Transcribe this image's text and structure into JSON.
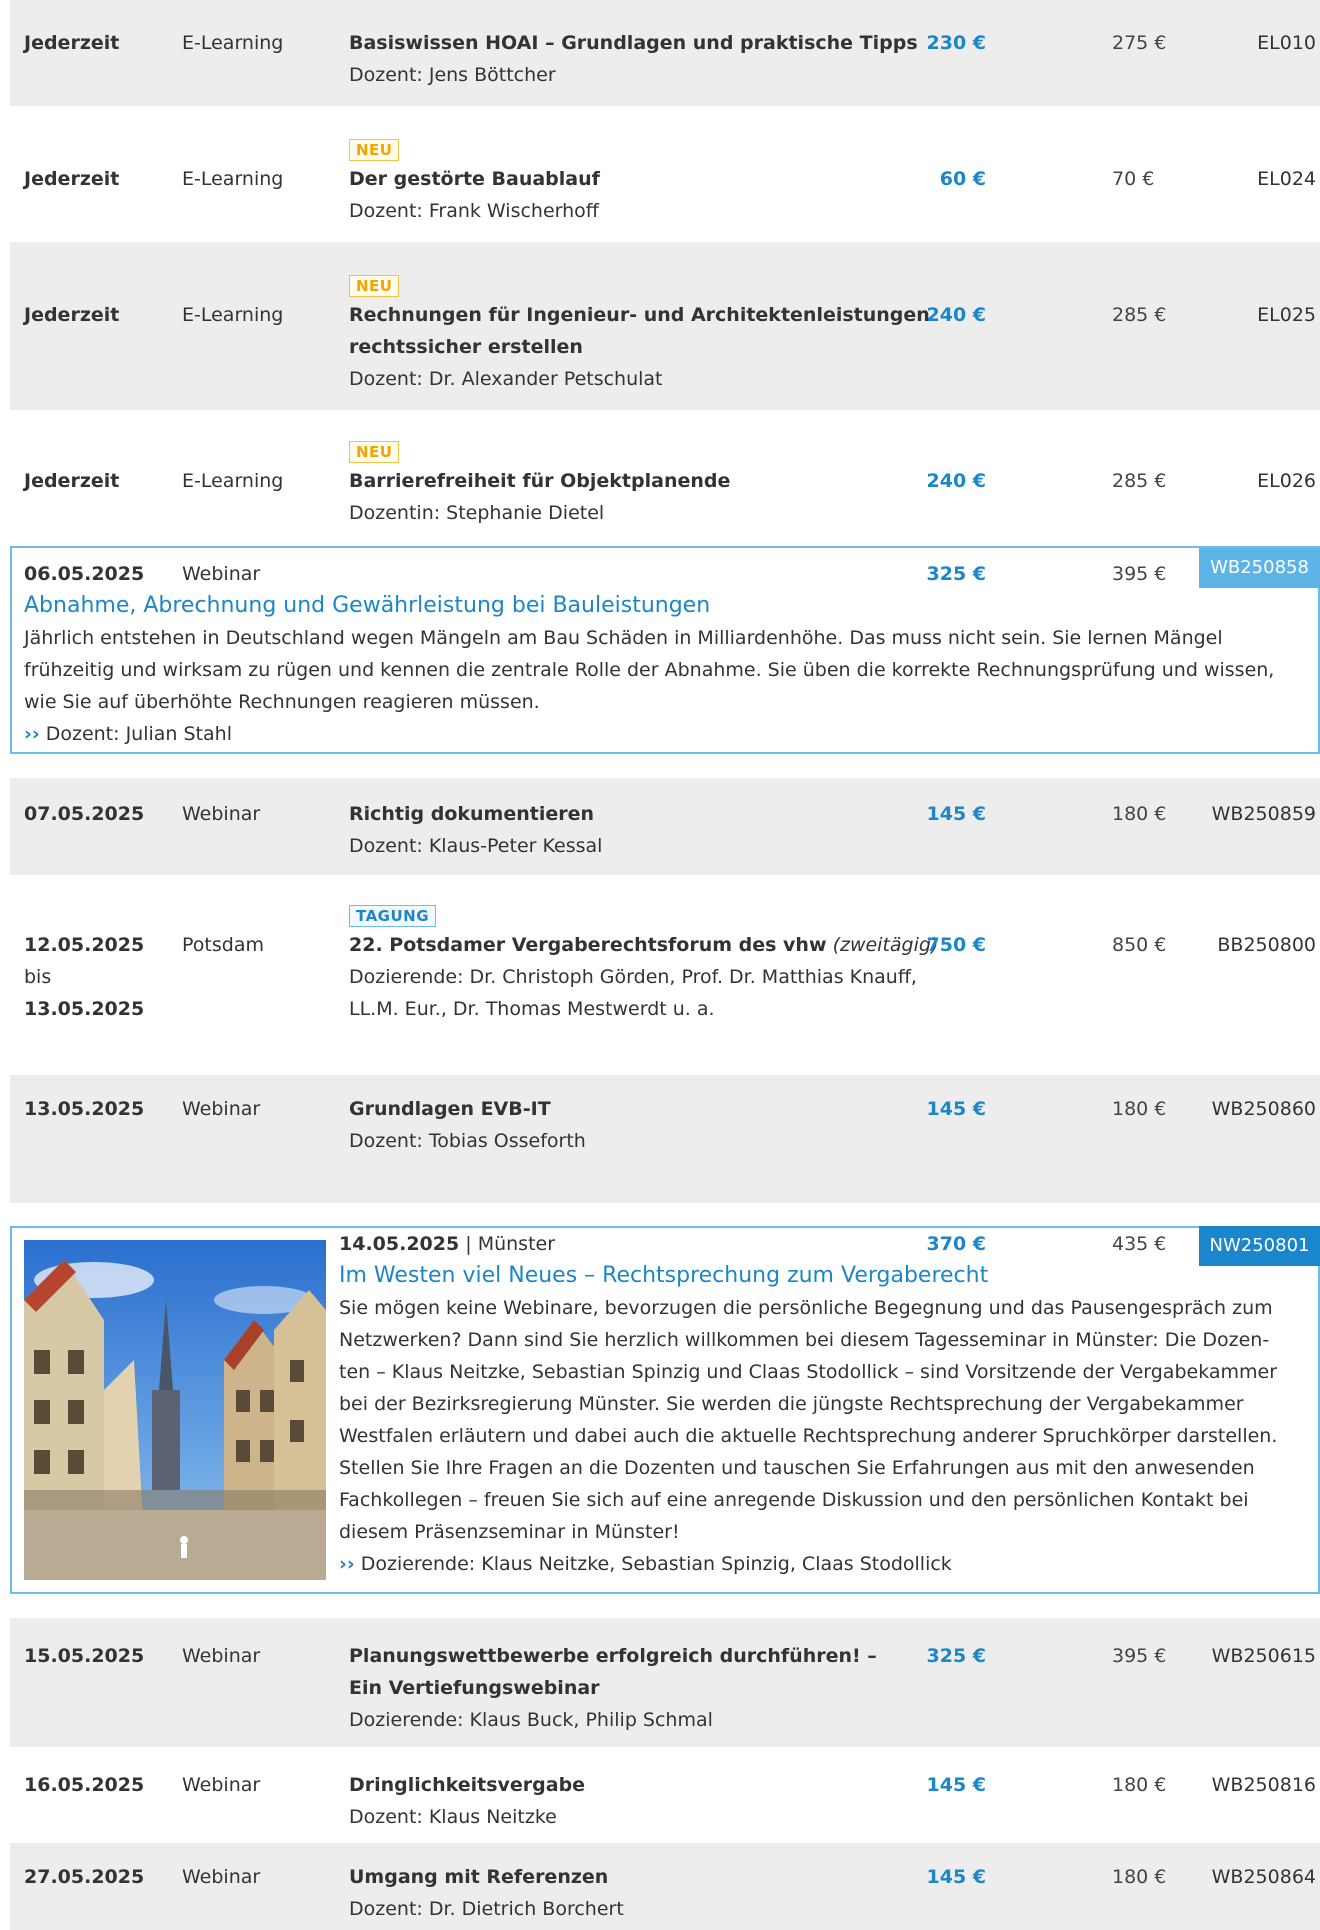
{
  "rows": [
    {
      "date": "Jederzeit",
      "type": "E-Learning",
      "title": "Basiswissen HOAI – Grundlagen und praktische Tipps",
      "lecturer": "Dozent: Jens Böttcher",
      "price_member": "230 €",
      "price_regular": "275 €",
      "code": "EL010"
    },
    {
      "badge": "NEU",
      "date": "Jederzeit",
      "type": "E-Learning",
      "title": "Der gestörte Bauablauf",
      "lecturer": "Dozent: Frank Wischerhoff",
      "price_member": "60 €",
      "price_regular": "70 €",
      "code": "EL024"
    },
    {
      "badge": "NEU",
      "date": "Jederzeit",
      "type": "E-Learning",
      "title_line1": "Rechnungen für Ingenieur- und Architektenleistungen",
      "title_line2": "rechtssicher erstellen",
      "lecturer": "Dozent: Dr. Alexander Petschulat",
      "price_member": "240 €",
      "price_regular": "285 €",
      "code": "EL025"
    },
    {
      "badge": "NEU",
      "date": "Jederzeit",
      "type": "E-Learning",
      "title": "Barrierefreiheit für Objektplanende",
      "lecturer": "Dozentin: Stephanie Dietel",
      "price_member": "240 €",
      "price_regular": "285 €",
      "code": "EL026"
    }
  ],
  "featured1": {
    "date": "06.05.2025",
    "type": "Webinar",
    "title": "Abnahme, Abrechnung und Gewährleistung bei Bauleistungen",
    "desc_line1": "Jährlich entstehen in Deutschland wegen Mängeln am Bau Schäden in Milliardenhöhe. Das muss nicht sein. Sie lernen Mängel",
    "desc_line2": "frühzeitig und wirksam zu rügen und kennen die zentrale Rolle der Abnahme. Sie üben die korrekte Rechnungsprüfung und wissen,",
    "desc_line3": "wie Sie auf überhöhte Rechnungen reagieren müssen.",
    "arrow": "››",
    "lecturer": "Dozent: Julian Stahl",
    "price_member": "325 €",
    "price_regular": "395 €",
    "code": "WB250858"
  },
  "rows2": [
    {
      "date": "07.05.2025",
      "type": "Webinar",
      "title": "Richtig dokumentieren",
      "lecturer": "Dozent: Klaus-Peter Kessal",
      "price_member": "145 €",
      "price_regular": "180 €",
      "code": "WB250859"
    },
    {
      "badge": "TAGUNG",
      "date": "12.05.2025",
      "date_mid": "bis",
      "date_end": "13.05.2025",
      "type": "Potsdam",
      "title": "22. Potsdamer Vergaberechtsforum des vhw",
      "title_suffix": "(zweitägig)",
      "lecturer_line1": "Dozierende: Dr. Christoph Görden, Prof. Dr. Matthias Knauff,",
      "lecturer_line2": "LL.M. Eur., Dr. Thomas Mestwerdt u. a.",
      "price_member": "750 €",
      "price_regular": "850 €",
      "code": "BB250800"
    },
    {
      "date": "13.05.2025",
      "type": "Webinar",
      "title": "Grundlagen EVB-IT",
      "lecturer": "Dozent: Tobias Osseforth",
      "price_member": "145 €",
      "price_regular": "180 €",
      "code": "WB250860"
    }
  ],
  "featured2": {
    "date": "14.05.2025",
    "separator": "|",
    "location": "Münster",
    "title": "Im Westen viel Neues – Rechtsprechung zum Vergaberecht",
    "desc_lines": [
      "Sie mögen keine Webinare, bevorzugen die persönliche Begegnung und das Pausengespräch zum",
      "Netzwerken? Dann sind Sie herzlich willkommen bei diesem Tagesseminar in Münster: Die Dozen-",
      "ten – Klaus Neitzke, Sebastian Spinzig und Claas Stodollick – sind Vorsitzende der Vergabekammer",
      "bei der Bezirksregierung Münster. Sie werden die jüngste Rechtsprechung der Vergabekammer",
      "Westfalen erläutern und dabei auch die aktuelle Rechtsprechung anderer Spruchkörper darstellen.",
      "Stellen Sie Ihre Fragen an die Dozenten und tauschen Sie Erfahrungen aus mit den anwesenden",
      "Fachkollegen – freuen Sie sich auf eine anregende Diskussion und den persönlichen Kontakt bei",
      "diesem Präsenzseminar in Münster!"
    ],
    "arrow": "››",
    "lecturer": "Dozierende: Klaus Neitzke, Sebastian Spinzig, Claas Stodollick",
    "price_member": "370 €",
    "price_regular": "435 €",
    "code": "NW250801"
  },
  "rows3": [
    {
      "date": "15.05.2025",
      "type": "Webinar",
      "title_line1": "Planungswettbewerbe erfolgreich durchführen! –",
      "title_line2": "Ein Vertiefungswebinar",
      "lecturer": "Dozierende: Klaus Buck, Philip Schmal",
      "price_member": "325 €",
      "price_regular": "395 €",
      "code": "WB250615"
    },
    {
      "date": "16.05.2025",
      "type": "Webinar",
      "title": "Dringlichkeitsvergabe",
      "lecturer": "Dozent: Klaus Neitzke",
      "price_member": "145 €",
      "price_regular": "180 €",
      "code": "WB250816"
    },
    {
      "date": "27.05.2025",
      "type": "Webinar",
      "title": "Umgang mit Referenzen",
      "lecturer": "Dozent: Dr. Dietrich Borchert",
      "price_member": "145 €",
      "price_regular": "180 €",
      "code": "WB250864"
    }
  ]
}
